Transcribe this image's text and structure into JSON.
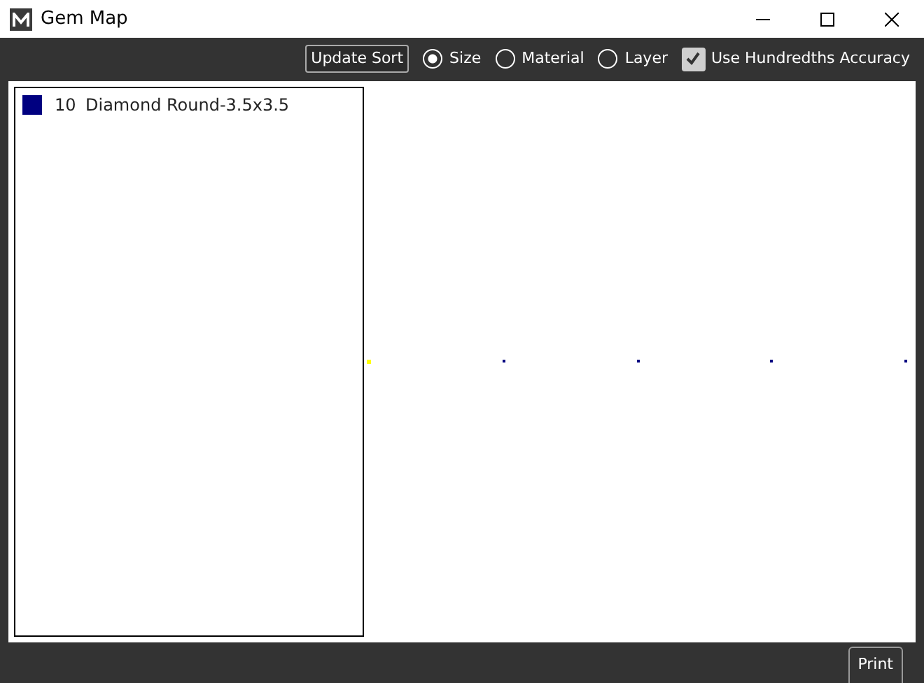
{
  "window": {
    "title": "Gem Map"
  },
  "toolbar": {
    "update_button": "Update Sort",
    "sort_options": [
      {
        "label": "Size",
        "selected": true
      },
      {
        "label": "Material",
        "selected": false
      },
      {
        "label": "Layer",
        "selected": false
      }
    ],
    "accuracy": {
      "label": "Use Hundredths Accuracy",
      "checked": true
    }
  },
  "gem_list": [
    {
      "color": "#000080",
      "count": "10",
      "name": "Diamond Round-3.5x3.5"
    }
  ],
  "gem_marks": [
    {
      "color": "#ffff00"
    },
    {
      "color": "#000080"
    },
    {
      "color": "#000080"
    },
    {
      "color": "#000080"
    },
    {
      "color": "#000080"
    }
  ],
  "print_button": "Print"
}
